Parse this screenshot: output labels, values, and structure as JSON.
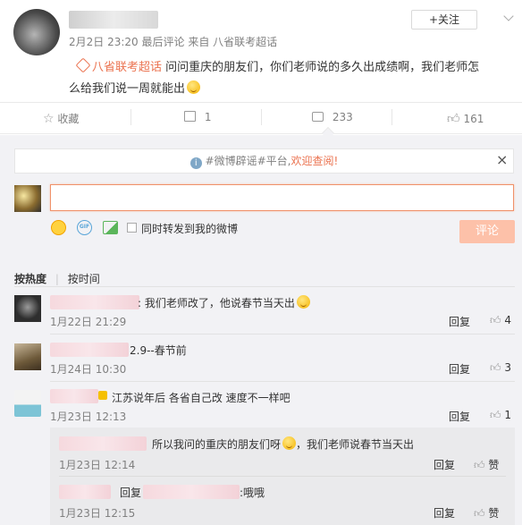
{
  "post": {
    "timestamp": "2月2日 23:20",
    "meta_suffix": "最后评论 来自 八省联考超话",
    "follow_label": "+关注",
    "topic_tag": "八省联考超话",
    "content_line1": "问问重庆的朋友们，你们老师说的多久出成绩啊，我们老师怎",
    "content_line2": "么给我们说一周就能出"
  },
  "actions": {
    "favorite_label": "收藏",
    "repost_count": "1",
    "comment_count": "233",
    "like_count": "161"
  },
  "notice": {
    "text_prefix": "#微博辟谣#平台,",
    "text_link": "欢迎查阅!",
    "close": "×"
  },
  "composer": {
    "input_value": "",
    "repost_checkbox_label": "同时转发到我的微博",
    "submit_label": "评论"
  },
  "sort": {
    "by_hot": "按热度",
    "by_time": "按时间"
  },
  "comments": [
    {
      "text": ": 我们老师改了，他说春节当天出",
      "time": "1月22日 21:29",
      "reply": "回复",
      "likes": "4"
    },
    {
      "text": "2.9--春节前",
      "time": "1月24日 10:30",
      "reply": "回复",
      "likes": "3"
    },
    {
      "text": "江苏说年后 各省自己改 速度不一样吧",
      "time": "1月23日 12:13",
      "reply": "回复",
      "likes": "1"
    }
  ],
  "replies": [
    {
      "text_a": "所以我问的重庆的朋友们呀",
      "text_b": "，我们老师说春节当天出",
      "time": "1月23日 12:14",
      "reply": "回复",
      "like": "赞"
    },
    {
      "prefix": "回复",
      "text": ":哦哦",
      "time": "1月23日 12:15",
      "reply": "回复",
      "like": "赞"
    }
  ],
  "colors": {
    "accent": "#eb7350",
    "link_blue": "#eb7350",
    "muted": "#808080",
    "button_disabled": "#fdc1a9"
  }
}
